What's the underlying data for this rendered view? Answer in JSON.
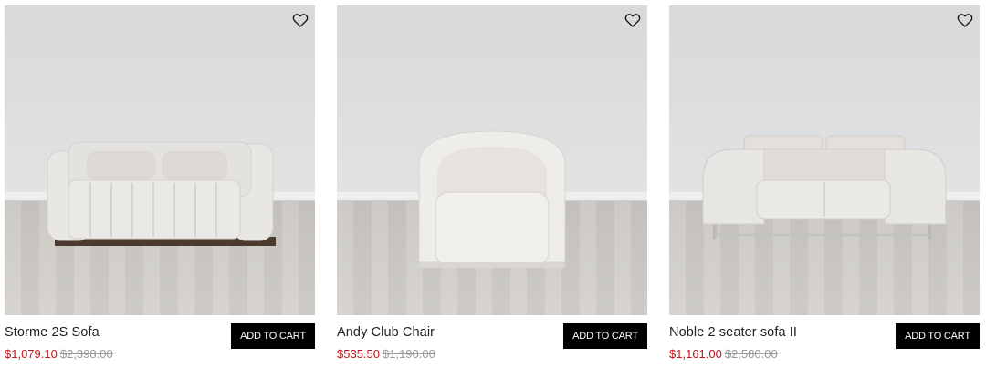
{
  "products": [
    {
      "name": "Storme 2S Sofa",
      "sale_price": "$1,079.10",
      "original_price": "$2,398.00",
      "cart_label": "ADD TO CART",
      "wishlist_icon": "heart-icon"
    },
    {
      "name": "Andy Club Chair",
      "sale_price": "$535.50",
      "original_price": "$1,190.00",
      "cart_label": "ADD TO CART",
      "wishlist_icon": "heart-icon"
    },
    {
      "name": "Noble 2 seater sofa II",
      "sale_price": "$1,161.00",
      "original_price": "$2,580.00",
      "cart_label": "ADD TO CART",
      "wishlist_icon": "heart-icon"
    }
  ],
  "colors": {
    "sale": "#c4161c",
    "original": "#9a9a9a",
    "button_bg": "#000000",
    "button_text": "#ffffff"
  }
}
